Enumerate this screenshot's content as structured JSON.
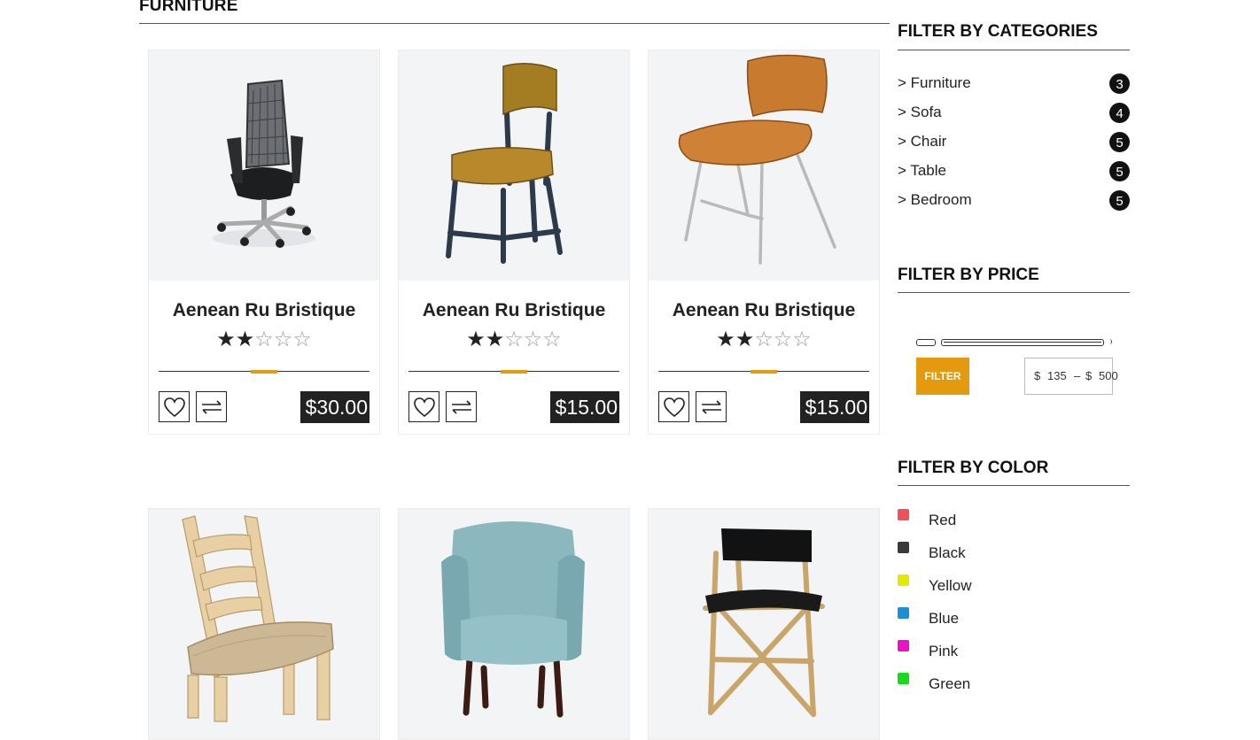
{
  "page": {
    "title": "FURNITURE"
  },
  "products": [
    {
      "name": "Aenean Ru Bristique",
      "rating": 2,
      "max_rating": 5,
      "price": "$30.00",
      "image": "office-chair"
    },
    {
      "name": "Aenean Ru Bristique",
      "rating": 2,
      "max_rating": 5,
      "price": "$15.00",
      "image": "school-chair"
    },
    {
      "name": "Aenean Ru Bristique",
      "rating": 2,
      "max_rating": 5,
      "price": "$15.00",
      "image": "plywood-chair"
    },
    {
      "image": "ladder-back-chair"
    },
    {
      "image": "blue-armchair"
    },
    {
      "image": "director-chair"
    }
  ],
  "icons": {
    "wishlist": "heart-icon",
    "compare": "compare-arrows-icon"
  },
  "sidebar": {
    "categories": {
      "title": "FILTER BY CATEGORIES",
      "items": [
        {
          "label": "> Furniture",
          "count": "3"
        },
        {
          "label": "> Sofa",
          "count": "4"
        },
        {
          "label": "> Chair",
          "count": "5"
        },
        {
          "label": "> Table",
          "count": "5"
        },
        {
          "label": "> Bedroom",
          "count": "5"
        }
      ]
    },
    "price": {
      "title": "FILTER BY PRICE",
      "button_label": "FILTER",
      "currency": "$",
      "separator": "–",
      "min": "135",
      "max": "500"
    },
    "color": {
      "title": "FILTER BY COLOR",
      "items": [
        {
          "label": "Red",
          "hex": "#f0505a"
        },
        {
          "label": "Black",
          "hex": "#3a3a3a"
        },
        {
          "label": "Yellow",
          "hex": "#e5e800"
        },
        {
          "label": "Blue",
          "hex": "#1b8ed6"
        },
        {
          "label": "Pink",
          "hex": "#ee10c9"
        },
        {
          "label": "Green",
          "hex": "#19d81e"
        }
      ]
    }
  },
  "theme": {
    "accent": "#e39a0f",
    "dark": "#222222",
    "image_bg": "#f2f4f6"
  }
}
